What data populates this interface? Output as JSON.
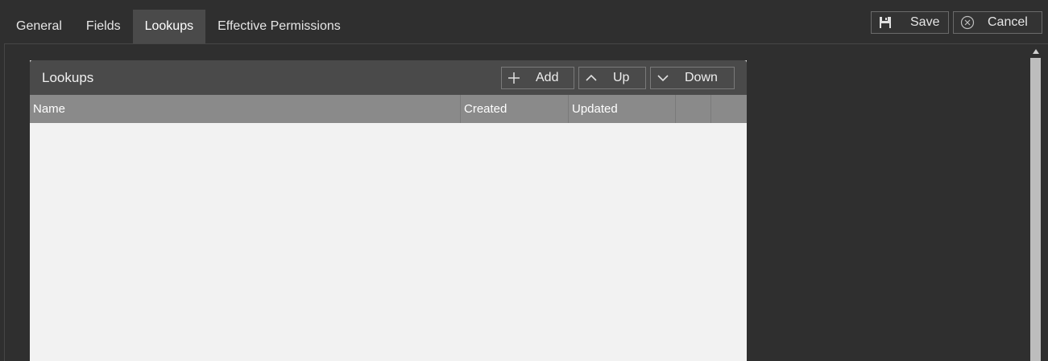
{
  "tabs": [
    {
      "label": "General"
    },
    {
      "label": "Fields"
    },
    {
      "label": "Lookups"
    },
    {
      "label": "Effective Permissions"
    }
  ],
  "active_tab": "Lookups",
  "toolbar": {
    "save_label": "Save",
    "save_icon": "floppy-disk-icon",
    "cancel_label": "Cancel",
    "cancel_icon": "circle-x-icon"
  },
  "lookups_panel": {
    "title": "Lookups",
    "add_label": "Add",
    "add_icon": "plus-icon",
    "up_label": "Up",
    "up_icon": "chevron-up-icon",
    "down_label": "Down",
    "down_icon": "chevron-down-icon",
    "columns": [
      "Name",
      "Created",
      "Updated",
      "",
      ""
    ],
    "rows": []
  },
  "colors": {
    "background": "#2f2f2f",
    "active_tab": "#4a4a4a",
    "panel_header": "#4a4a4a",
    "grid_header": "#8a8a8a",
    "grid_body": "#f2f2f2",
    "scroll_thumb": "#bdbdbd"
  }
}
